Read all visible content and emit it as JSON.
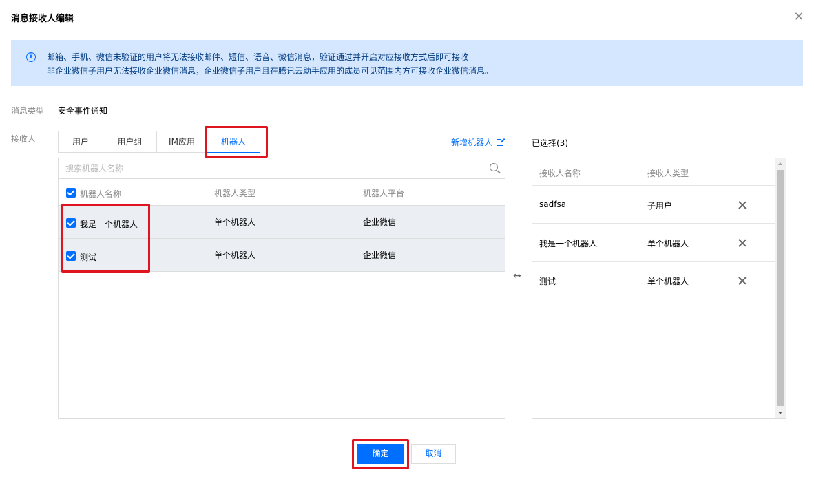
{
  "dialog": {
    "title": "消息接收人编辑",
    "close_icon": "close-icon"
  },
  "notice": {
    "icon": "info-icon",
    "line1": "邮箱、手机、微信未验证的用户将无法接收邮件、短信、语音、微信消息，验证通过并开启对应接收方式后即可接收",
    "line2": "非企业微信子用户无法接收企业微信消息，企业微信子用户且在腾讯云助手应用的成员可见范围内方可接收企业微信消息。"
  },
  "form": {
    "msg_type_label": "消息类型",
    "msg_type_value": "安全事件通知",
    "receiver_label": "接收人"
  },
  "tabs": [
    {
      "label": "用户",
      "active": false
    },
    {
      "label": "用户组",
      "active": false
    },
    {
      "label": "IM应用",
      "active": false
    },
    {
      "label": "机器人",
      "active": true
    }
  ],
  "add_robot": {
    "label": "新增机器人",
    "icon": "external-link-icon"
  },
  "search": {
    "placeholder": "搜索机器人名称",
    "value": ""
  },
  "table": {
    "columns": [
      "机器人名称",
      "机器人类型",
      "机器人平台"
    ],
    "header_checked": true,
    "rows": [
      {
        "name": "我是一个机器人",
        "type": "单个机器人",
        "platform": "企业微信",
        "checked": true
      },
      {
        "name": "测试",
        "type": "单个机器人",
        "platform": "企业微信",
        "checked": true
      }
    ]
  },
  "swap_icon": "↔",
  "selected": {
    "title": "已选择(3)",
    "columns": [
      "接收人名称",
      "接收人类型"
    ],
    "rows": [
      {
        "name": "sadfsa",
        "type": "子用户"
      },
      {
        "name": "我是一个机器人",
        "type": "单个机器人"
      },
      {
        "name": "测试",
        "type": "单个机器人"
      }
    ]
  },
  "buttons": {
    "ok": "确定",
    "cancel": "取消"
  },
  "colors": {
    "accent": "#006eff",
    "highlight": "#e0141e",
    "notice_bg": "#d5e7ff"
  }
}
